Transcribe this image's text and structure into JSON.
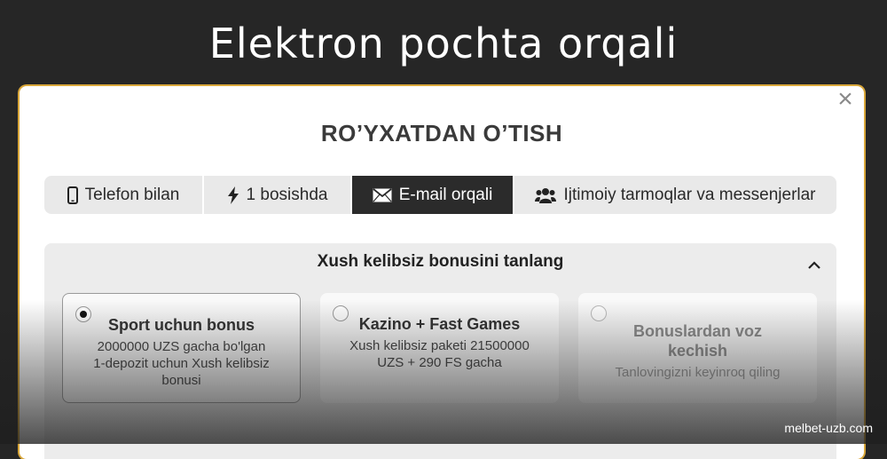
{
  "page": {
    "headline": "Elektron pochta orqali",
    "watermark": "melbet-uzb.com"
  },
  "modal": {
    "title": "RO’YXATDAN O’TISH",
    "close_icon": "close-icon",
    "tabs": [
      {
        "label": "Telefon bilan",
        "icon": "phone-icon",
        "active": false
      },
      {
        "label": "1 bosishda",
        "icon": "lightning-icon",
        "active": false
      },
      {
        "label": "E-mail orqali",
        "icon": "envelope-icon",
        "active": true
      },
      {
        "label": "Ijtimoiy tarmoqlar va messenjerlar",
        "icon": "users-icon",
        "active": false
      }
    ],
    "bonus": {
      "title": "Xush kelibsiz bonusini tanlang",
      "collapse_icon": "chevron-up-icon",
      "options": [
        {
          "title": "Sport uchun bonus",
          "description": "2000000 UZS gacha bo'lgan 1-depozit uchun Xush kelibsiz bonusi",
          "selected": true
        },
        {
          "title": "Kazino + Fast Games",
          "description": "Xush kelibsiz paketi 21500000 UZS + 290 FS gacha",
          "selected": false
        },
        {
          "title": "Bonuslardan voz kechish",
          "description": "Tanlovingizni keyinroq qiling",
          "selected": false
        }
      ]
    }
  },
  "colors": {
    "background": "#262626",
    "active_tab": "#2b2b2b",
    "modal_border": "#d9a73a",
    "panel": "#ececec"
  }
}
